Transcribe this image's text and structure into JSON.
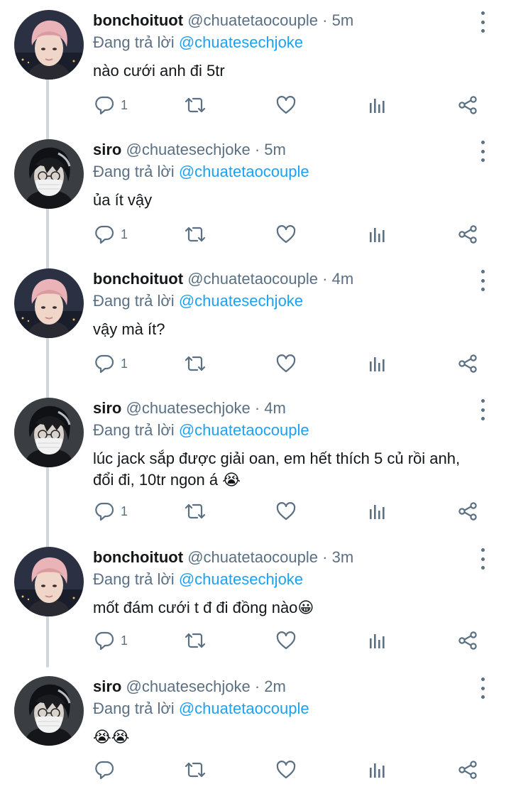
{
  "colors": {
    "name": "#14171a",
    "muted": "#5b7083",
    "mention": "#1da1f2",
    "thread_line": "#d0d6db"
  },
  "labels": {
    "replying_to": "Đang trả lời",
    "separator": "·"
  },
  "tweets": [
    {
      "name": "bonchoituot",
      "handle": "@chuatetaocouple",
      "time": "5m",
      "reply_to": "@chuatesechjoke",
      "text": "nào cưới anh đi 5tr",
      "replies": "1",
      "avatar_icon": "pink-hair-avatar"
    },
    {
      "name": "siro",
      "handle": "@chuatesechjoke",
      "time": "5m",
      "reply_to": "@chuatetaocouple",
      "text": "ủa ít vậy",
      "replies": "1",
      "avatar_icon": "masked-avatar"
    },
    {
      "name": "bonchoituot",
      "handle": "@chuatetaocouple",
      "time": "4m",
      "reply_to": "@chuatesechjoke",
      "text": "vậy mà ít?",
      "replies": "1",
      "avatar_icon": "pink-hair-avatar"
    },
    {
      "name": "siro",
      "handle": "@chuatesechjoke",
      "time": "4m",
      "reply_to": "@chuatetaocouple",
      "text": "lúc jack sắp được giải oan, em hết thích 5 củ rồi anh, đổi đi, 10tr ngon á 😭",
      "replies": "1",
      "avatar_icon": "masked-avatar"
    },
    {
      "name": "bonchoituot",
      "handle": "@chuatetaocouple",
      "time": "3m",
      "reply_to": "@chuatesechjoke",
      "text": "mốt đám cưới t đ đi đồng nào😀",
      "replies": "1",
      "avatar_icon": "pink-hair-avatar"
    },
    {
      "name": "siro",
      "handle": "@chuatesechjoke",
      "time": "2m",
      "reply_to": "@chuatetaocouple",
      "text": "😭😭",
      "replies": "",
      "avatar_icon": "masked-avatar"
    }
  ]
}
